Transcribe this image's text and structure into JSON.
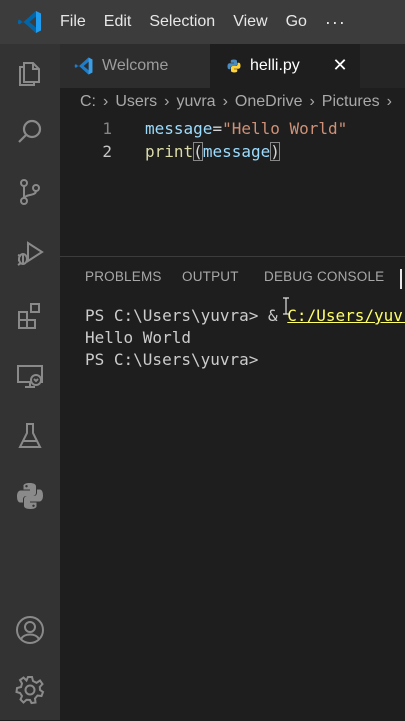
{
  "menu": {
    "items": [
      "File",
      "Edit",
      "Selection",
      "View",
      "Go"
    ],
    "more": "···"
  },
  "activity_bar": {
    "icons": [
      "files-icon",
      "search-icon",
      "source-control-icon",
      "run-debug-icon",
      "extensions-icon",
      "remote-explorer-icon",
      "testing-icon",
      "python-icon",
      "account-icon",
      "settings-gear-icon"
    ]
  },
  "tabs": [
    {
      "label": "Welcome",
      "icon": "vscode-icon",
      "active": false
    },
    {
      "label": "helli.py",
      "icon": "python-file-icon",
      "active": true,
      "close": "✕"
    }
  ],
  "breadcrumb": {
    "items": [
      "C:",
      "Users",
      "yuvra",
      "OneDrive",
      "Pictures"
    ]
  },
  "editor": {
    "lines": [
      {
        "number": "1",
        "var": "message",
        "op": "=",
        "str": "\"Hello World\""
      },
      {
        "number": "2",
        "fn": "print",
        "open": "(",
        "arg": "message",
        "close": ")"
      }
    ]
  },
  "panel": {
    "tabs": [
      "PROBLEMS",
      "OUTPUT",
      "DEBUG CONSOLE"
    ]
  },
  "terminal": {
    "line1_prompt": "PS C:\\Users\\yuvra> & ",
    "line1_path": "C:/Users/yuvra",
    "line2": "Hello World",
    "line3": "PS C:\\Users\\yuvra>"
  },
  "colors": {
    "titlebar": "#3c3c3c",
    "activitybar": "#333333",
    "editor_bg": "#1e1e1e",
    "string": "#ce9178",
    "variable": "#9cdcfe",
    "function": "#dcdcaa",
    "terminal_path": "#ffff66"
  }
}
